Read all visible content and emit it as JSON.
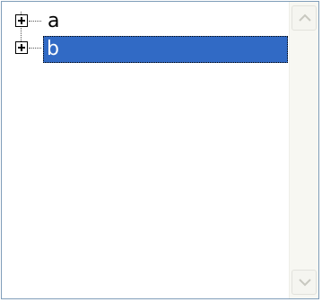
{
  "tree": {
    "nodes": [
      {
        "label": "a",
        "expanded": false,
        "selected": false
      },
      {
        "label": "b",
        "expanded": false,
        "selected": true
      }
    ]
  },
  "scrollbar": {
    "up_icon": "chevron-up-icon",
    "down_icon": "chevron-down-icon",
    "enabled": false
  },
  "colors": {
    "selection": "#316ac5",
    "selection_text": "#ffffff",
    "border": "#7f9db9"
  }
}
